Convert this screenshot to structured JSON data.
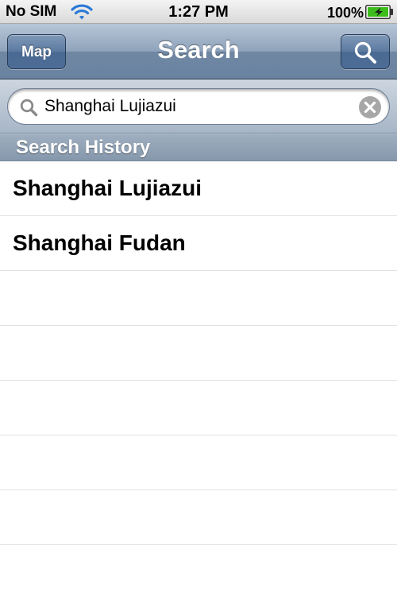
{
  "status_bar": {
    "carrier": "No SIM",
    "time": "1:27 PM",
    "battery_percent": "100%",
    "wifi_icon": "wifi-icon",
    "battery_icon": "battery-charging-icon"
  },
  "nav_bar": {
    "title": "Search",
    "map_button_label": "Map",
    "search_button_icon": "search-icon"
  },
  "search_bar": {
    "value": "Shanghai Lujiazui",
    "placeholder": "",
    "leading_icon": "magnifier-icon",
    "clear_icon": "clear-icon"
  },
  "history": {
    "section_title": "Search History",
    "items": [
      {
        "label": "Shanghai Lujiazui"
      },
      {
        "label": "Shanghai Fudan"
      }
    ]
  },
  "colors": {
    "nav_bar": "#7f95b0",
    "button": "#5a78a0",
    "section_header": "#8f9fb3",
    "battery_fill": "#3cbd1c"
  }
}
